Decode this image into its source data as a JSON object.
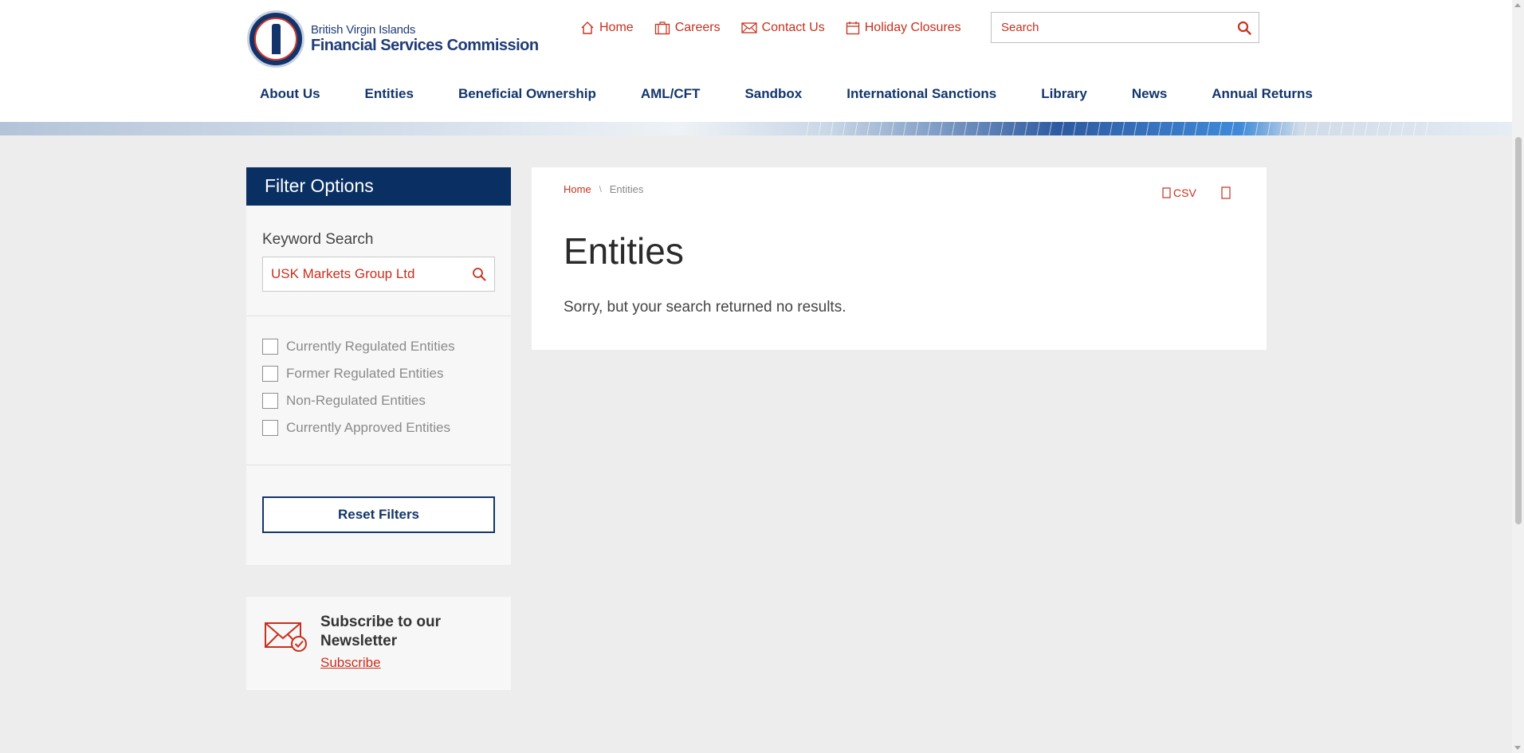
{
  "header": {
    "logo": {
      "line1": "British Virgin Islands",
      "line2": "Financial Services Commission"
    },
    "utility_links": [
      {
        "label": "Home",
        "icon": "home-icon"
      },
      {
        "label": "Careers",
        "icon": "briefcase-icon"
      },
      {
        "label": "Contact Us",
        "icon": "envelope-icon"
      },
      {
        "label": "Holiday Closures",
        "icon": "calendar-icon"
      }
    ],
    "search": {
      "placeholder": "Search"
    },
    "nav": [
      "About Us",
      "Entities",
      "Beneficial Ownership",
      "AML/CFT",
      "Sandbox",
      "International Sanctions",
      "Library",
      "News",
      "Annual Returns"
    ]
  },
  "sidebar": {
    "filter_title": "Filter Options",
    "keyword_label": "Keyword Search",
    "keyword_value": "USK Markets Group Ltd",
    "checkboxes": [
      "Currently Regulated Entities",
      "Former Regulated Entities",
      "Non-Regulated Entities",
      "Currently Approved Entities"
    ],
    "reset_label": "Reset Filters",
    "newsletter": {
      "title": "Subscribe to our Newsletter",
      "link": "Subscribe"
    }
  },
  "content": {
    "breadcrumb": {
      "home": "Home",
      "separator": "\\",
      "current": "Entities"
    },
    "csv_label": "CSV",
    "title": "Entities",
    "message": "Sorry, but your search returned no results."
  },
  "colors": {
    "accent_red": "#c8301e",
    "navy": "#0a3063",
    "background": "#ededed"
  }
}
